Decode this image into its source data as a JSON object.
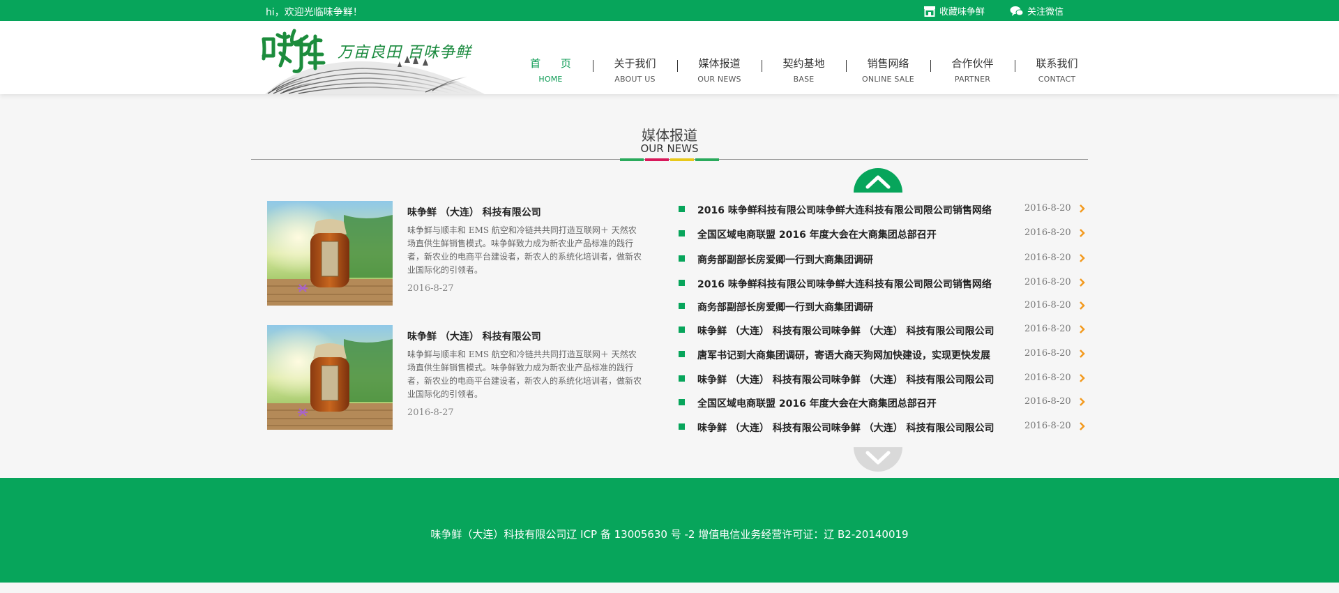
{
  "topbar": {
    "greeting": "hi，欢迎光临味争鲜！",
    "bookmark_label": "收藏味争鲜",
    "wechat_label": "关注微信"
  },
  "header": {
    "logo_text": "味争鲜",
    "slogan": "万亩良田 百味争鲜",
    "nav": [
      {
        "zh": "首 页",
        "en": "HOME"
      },
      {
        "zh": "关于我们",
        "en": "ABOUT US"
      },
      {
        "zh": "媒体报道",
        "en": "OUR NEWS"
      },
      {
        "zh": "契约基地",
        "en": "BASE"
      },
      {
        "zh": "销售网络",
        "en": "ONLINE SALE"
      },
      {
        "zh": "合作伙伴",
        "en": "PARTNER"
      },
      {
        "zh": "联系我们",
        "en": "CONTACT"
      }
    ]
  },
  "section": {
    "title_zh": "媒体报道",
    "title_en": "OUR NEWS",
    "bar_colors": [
      "#2aaa5c",
      "#d8185a",
      "#e8c81a",
      "#2aaa5c"
    ]
  },
  "cards": [
    {
      "title": "味争鲜 （大连） 科技有限公司",
      "desc": "味争鲜与顺丰和 EMS 航空和冷链共共同打造互联网＋ 天然农场直供生鲜销售模式。味争鲜致力成为新农业产品标准的践行者，新农业的电商平台建设者，新农人的系统化培训者，做新农业国际化的引领者。",
      "date": "2016-8-27"
    },
    {
      "title": "味争鲜 （大连） 科技有限公司",
      "desc": "味争鲜与顺丰和 EMS 航空和冷链共共同打造互联网＋ 天然农场直供生鲜销售模式。味争鲜致力成为新农业产品标准的践行者，新农业的电商平台建设者，新农人的系统化培训者，做新农业国际化的引领者。",
      "date": "2016-8-27"
    }
  ],
  "news": [
    {
      "text": "2016 味争鲜科技有限公司味争鲜大连科技有限公司限公司销售网络",
      "date": "2016-8-20"
    },
    {
      "text": "全国区域电商联盟 2016 年度大会在大商集团总部召开",
      "date": "2016-8-20"
    },
    {
      "text": "商务部副部长房爱卿一行到大商集团调研",
      "date": "2016-8-20"
    },
    {
      "text": "2016 味争鲜科技有限公司味争鲜大连科技有限公司限公司销售网络",
      "date": "2016-8-20"
    },
    {
      "text": "商务部副部长房爱卿一行到大商集团调研",
      "date": "2016-8-20"
    },
    {
      "text": "味争鲜 （大连） 科技有限公司味争鲜 （大连） 科技有限公司限公司",
      "date": "2016-8-20"
    },
    {
      "text": "唐军书记到大商集团调研，寄语大商天狗网加快建设，实现更快发展",
      "date": "2016-8-20"
    },
    {
      "text": "味争鲜 （大连） 科技有限公司味争鲜 （大连） 科技有限公司限公司",
      "date": "2016-8-20"
    },
    {
      "text": "全国区域电商联盟 2016 年度大会在大商集团总部召开",
      "date": "2016-8-20"
    },
    {
      "text": "味争鲜 （大连） 科技有限公司味争鲜 （大连） 科技有限公司限公司",
      "date": "2016-8-20"
    }
  ],
  "footer": {
    "text": "味争鲜（大连）科技有限公司辽 ICP 备 13005630 号 -2 增值电信业务经营许可证：辽 B2-20140019"
  },
  "colors": {
    "brand_green": "#07a55b",
    "chevron_orange": "#f39a1e"
  },
  "icons": {
    "bookmark": "shop-icon",
    "wechat": "wechat-icon",
    "list_arrow": "chevron-right-icon",
    "scroll_up": "chevron-up-icon",
    "scroll_down": "chevron-down-icon"
  }
}
